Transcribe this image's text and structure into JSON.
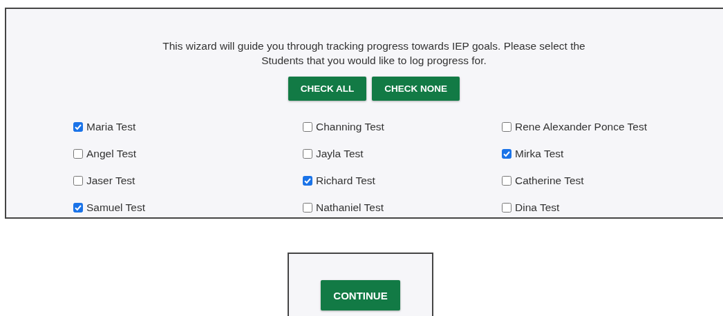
{
  "intro": "This wizard will guide you through tracking progress towards IEP goals. Please select the Students that you would like to log progress for.",
  "buttons": [
    "CHECK ALL",
    "CHECK NONE"
  ],
  "students": [
    {
      "name": "Maria Test",
      "checked": true
    },
    {
      "name": "Channing Test",
      "checked": false
    },
    {
      "name": "Rene Alexander Ponce Test",
      "checked": false
    },
    {
      "name": "Angel Test",
      "checked": false
    },
    {
      "name": "Jayla Test",
      "checked": false
    },
    {
      "name": "Mirka Test",
      "checked": true
    },
    {
      "name": "Jaser Test",
      "checked": false
    },
    {
      "name": "Richard Test",
      "checked": true
    },
    {
      "name": "Catherine Test",
      "checked": false
    },
    {
      "name": "Samuel Test",
      "checked": true
    },
    {
      "name": "Nathaniel Test",
      "checked": false
    },
    {
      "name": "Dina Test",
      "checked": false
    }
  ],
  "continue_button": "CONTINUE"
}
